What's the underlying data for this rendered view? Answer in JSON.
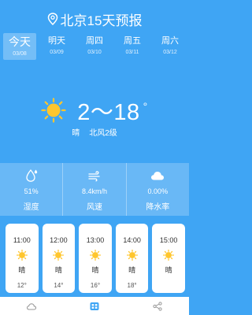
{
  "header": {
    "title": "北京15天预报",
    "icon": "location-pin-icon"
  },
  "days": [
    {
      "name": "今天",
      "date": "03/08",
      "active": true
    },
    {
      "name": "明天",
      "date": "03/09"
    },
    {
      "name": "周四",
      "date": "03/10"
    },
    {
      "name": "周五",
      "date": "03/11"
    },
    {
      "name": "周六",
      "date": "03/12"
    }
  ],
  "current": {
    "temp_range": "2～18",
    "degree": "°",
    "condition": "晴",
    "wind": "北风2级",
    "icon": "sun-icon"
  },
  "stats": [
    {
      "value": "51%",
      "label": "湿度",
      "icon": "humidity-icon"
    },
    {
      "value": "8.4km/h",
      "label": "风速",
      "icon": "wind-icon"
    },
    {
      "value": "0.00%",
      "label": "降水率",
      "icon": "cloud-icon"
    }
  ],
  "hourly": [
    {
      "time": "11:00",
      "condition": "晴",
      "temp": "12°"
    },
    {
      "time": "12:00",
      "condition": "晴",
      "temp": "14°"
    },
    {
      "time": "13:00",
      "condition": "晴",
      "temp": "16°"
    },
    {
      "time": "14:00",
      "condition": "晴",
      "temp": "18°"
    },
    {
      "time": "15:00",
      "condition": "晴",
      "temp": ""
    }
  ],
  "tabbar": [
    {
      "icon": "weather-tab-icon"
    },
    {
      "icon": "grid-tab-icon",
      "active": true
    },
    {
      "icon": "share-tab-icon"
    }
  ],
  "colors": {
    "background": "#3fa5f4",
    "sun": "#ffc62e",
    "tab_active": "#3fa5f4",
    "tab_inactive": "#999999"
  }
}
